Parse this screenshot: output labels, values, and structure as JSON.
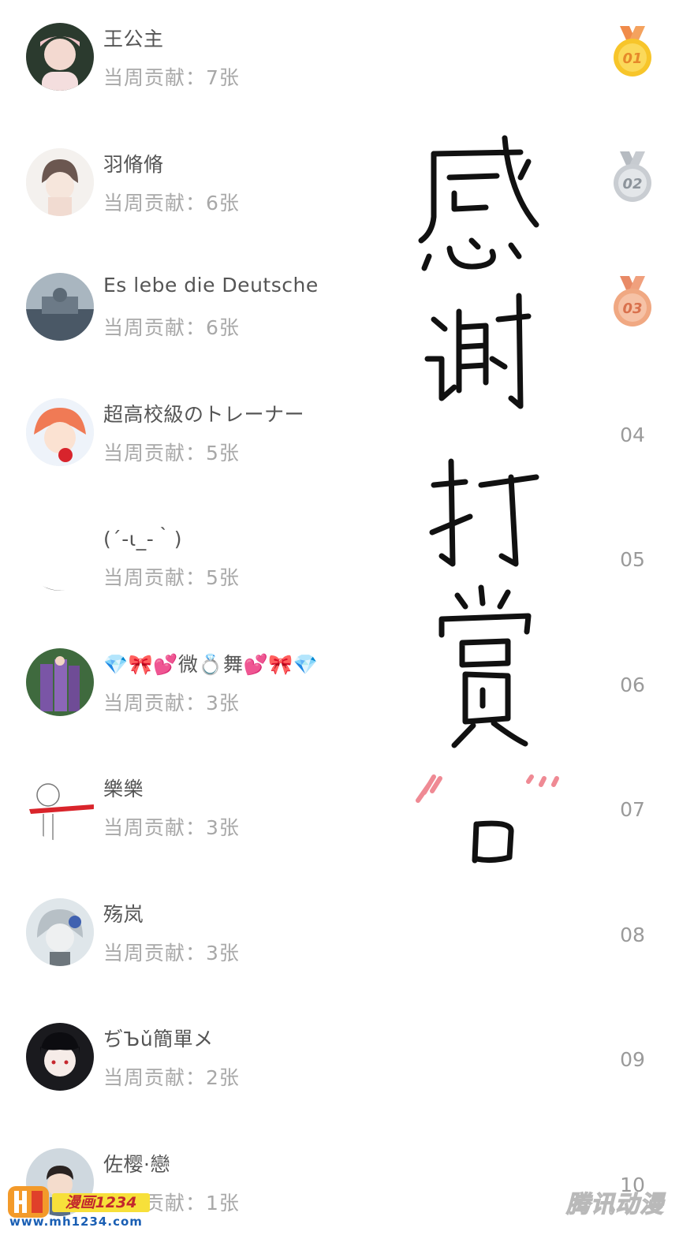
{
  "ranking": [
    {
      "rank": "01",
      "medal": "gold",
      "name": "王公主",
      "contribution": "当周贡献：7张"
    },
    {
      "rank": "02",
      "medal": "silver",
      "name": "羽脩脩",
      "contribution": "当周贡献：6张"
    },
    {
      "rank": "03",
      "medal": "bronze",
      "name": "Es lebe die Deutsche",
      "contribution": "当周贡献：6张"
    },
    {
      "rank": "04",
      "medal": null,
      "name": "超高校級のトレーナー",
      "contribution": "当周贡献：5张"
    },
    {
      "rank": "05",
      "medal": null,
      "name": "(´-ι_-｀)",
      "contribution": "当周贡献：5张"
    },
    {
      "rank": "06",
      "medal": null,
      "name": "💎🎀💕微💍舞💕🎀💎",
      "contribution": "当周贡献：3张"
    },
    {
      "rank": "07",
      "medal": null,
      "name": "樂樂",
      "contribution": "当周贡献：3张"
    },
    {
      "rank": "08",
      "medal": null,
      "name": "殇岚",
      "contribution": "当周贡献：3张"
    },
    {
      "rank": "09",
      "medal": null,
      "name": "ぢЪǔ簡單メ",
      "contribution": "当周贡献：2张"
    },
    {
      "rank": "10",
      "medal": null,
      "name": "佐樱·戀",
      "contribution": "当周贡献：1张"
    }
  ],
  "thanks_overlay": {
    "text": "感谢打赏"
  },
  "watermarks": {
    "left_badge": "漫画1234",
    "left_url": "www.mh1234.com",
    "right_logo": "腾讯动漫"
  },
  "colors": {
    "gold": "#f7c52a",
    "silver": "#c9cdd2",
    "bronze": "#f0a882",
    "rank_text": "#9a9a9a"
  }
}
